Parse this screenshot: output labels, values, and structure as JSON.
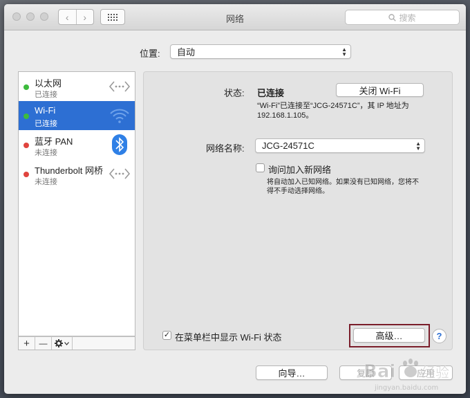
{
  "window": {
    "title": "网络"
  },
  "toolbar": {
    "search_placeholder": "搜索"
  },
  "location": {
    "label": "位置:",
    "value": "自动"
  },
  "services": [
    {
      "name": "以太网",
      "status": "已连接",
      "dot_color": "#3dbb3d",
      "icon": "ethernet-icon",
      "selected": false
    },
    {
      "name": "Wi-Fi",
      "status": "已连接",
      "dot_color": "#3dbb3d",
      "icon": "wifi-icon",
      "selected": true
    },
    {
      "name": "蓝牙 PAN",
      "status": "未连接",
      "dot_color": "#e0443e",
      "icon": "bluetooth-icon",
      "selected": false
    },
    {
      "name": "Thunderbolt 网桥",
      "status": "未连接",
      "dot_color": "#e0443e",
      "icon": "thunderbolt-bridge-icon",
      "selected": false
    }
  ],
  "sidebar_tools": {
    "add": "+",
    "remove": "—",
    "gear": "✱"
  },
  "detail": {
    "status_label": "状态:",
    "status_value": "已连接",
    "toggle_button": "关闭 Wi-Fi",
    "status_note_1": "“Wi-Fi”已连接至“JCG-24571C”，其 IP 地址为",
    "status_note_2": "192.168.1.105。",
    "network_name_label": "网络名称:",
    "network_name_value": "JCG-24571C",
    "ask_join_label": "询问加入新网络",
    "ask_join_checked": false,
    "ask_join_note_1": "将自动加入已知网络。如果没有已知网络，您将不",
    "ask_join_note_2": "得不手动选择网络。",
    "show_menubar_label": "在菜单栏中显示 Wi-Fi 状态",
    "show_menubar_checked": true,
    "advanced_button": "高级…",
    "help": "?"
  },
  "footer": {
    "assistant_button": "向导…",
    "revert_button": "复原",
    "apply_button": "应用"
  },
  "watermark": {
    "text": "Bai 经验",
    "sub": "jingyan.baidu.com"
  },
  "colors": {
    "selection": "#2d6fd3",
    "highlight_border": "#7a1d2a"
  }
}
